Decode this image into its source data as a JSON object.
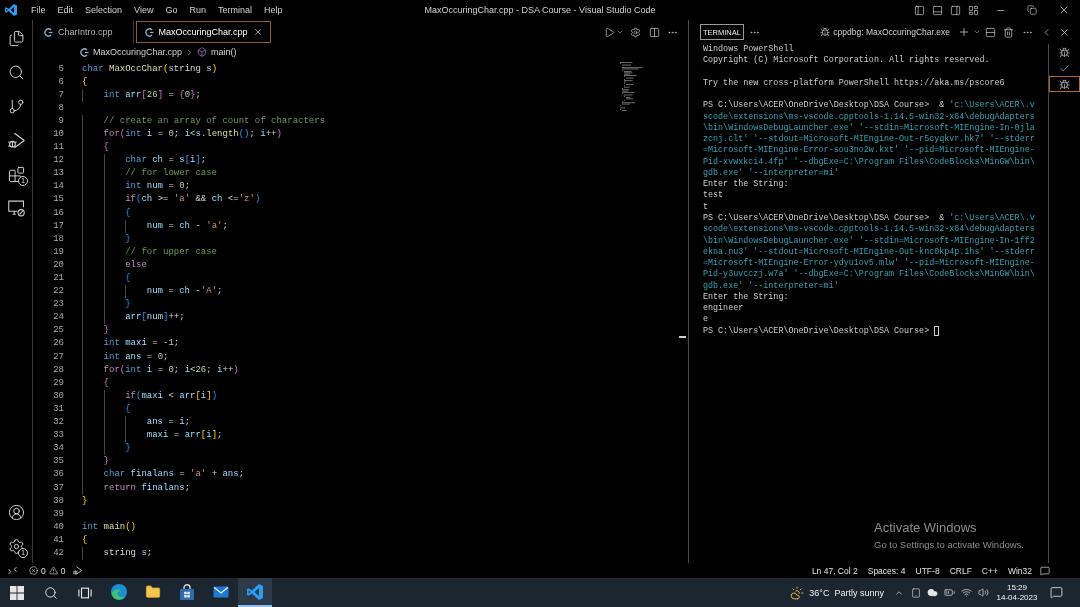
{
  "title_bar": {
    "menu": [
      "File",
      "Edit",
      "Selection",
      "View",
      "Go",
      "Run",
      "Terminal",
      "Help"
    ],
    "title": "MaxOccuringChar.cpp - DSA Course - Visual Studio Code"
  },
  "activity_bar": {
    "top": [
      {
        "kind": "explorer"
      },
      {
        "kind": "search"
      },
      {
        "kind": "source_control"
      },
      {
        "kind": "run_debug"
      },
      {
        "kind": "extensions",
        "badge": "1"
      },
      {
        "kind": "remote_explorer"
      }
    ],
    "bottom": [
      {
        "kind": "account"
      },
      {
        "kind": "manage",
        "badge": "1"
      }
    ]
  },
  "editor": {
    "tabs": [
      {
        "label": "CharIntro.cpp",
        "selected": false
      },
      {
        "label": "MaxOccuringChar.cpp",
        "selected": true
      }
    ],
    "breadcrumb": {
      "file": "MaxOccuringChar.cpp",
      "symbol": "main()"
    },
    "lines": [
      {
        "number": "5",
        "tokens": [
          {
            "text": "char",
            "kind": "type"
          },
          {
            "text": " MaxOccChar",
            "kind": "function"
          },
          {
            "text": "(",
            "kind": "bracket1"
          },
          {
            "text": "string s",
            "kind": "plain"
          },
          {
            "text": ")",
            "kind": "bracket1"
          }
        ]
      },
      {
        "number": "6",
        "tokens": [
          {
            "text": "{",
            "kind": "bracket1"
          }
        ]
      },
      {
        "number": "7",
        "tokens": [
          {
            "text": "    int",
            "kind": "type"
          },
          {
            "text": " arr",
            "kind": "variable"
          },
          {
            "text": "[",
            "kind": "bracket2"
          },
          {
            "text": "26",
            "kind": "number"
          },
          {
            "text": "]",
            "kind": "bracket2"
          },
          {
            "text": " = ",
            "kind": "plain"
          },
          {
            "text": "{",
            "kind": "bracket2"
          },
          {
            "text": "0",
            "kind": "number"
          },
          {
            "text": "}",
            "kind": "bracket2"
          },
          {
            "text": ";",
            "kind": "plain"
          }
        ]
      },
      {
        "number": "8"
      },
      {
        "number": "9",
        "tokens": [
          {
            "text": "    // create an array of count of characters",
            "kind": "comment"
          }
        ]
      },
      {
        "number": "10",
        "tokens": [
          {
            "text": "    for",
            "kind": "control"
          },
          {
            "text": "(",
            "kind": "bracket2"
          },
          {
            "text": "int",
            "kind": "type"
          },
          {
            "text": " i",
            "kind": "variable"
          },
          {
            "text": " = ",
            "kind": "plain"
          },
          {
            "text": "0",
            "kind": "number"
          },
          {
            "text": "; ",
            "kind": "plain"
          },
          {
            "text": "i",
            "kind": "variable"
          },
          {
            "text": "<",
            "kind": "plain"
          },
          {
            "text": "s",
            "kind": "variable"
          },
          {
            "text": ".",
            "kind": "plain"
          },
          {
            "text": "length",
            "kind": "function"
          },
          {
            "text": "()",
            "kind": "bracket3"
          },
          {
            "text": "; ",
            "kind": "plain"
          },
          {
            "text": "i",
            "kind": "variable"
          },
          {
            "text": "++",
            "kind": "plain"
          },
          {
            "text": ")",
            "kind": "bracket2"
          }
        ]
      },
      {
        "number": "11",
        "tokens": [
          {
            "text": "    {",
            "kind": "bracket2"
          }
        ]
      },
      {
        "number": "12",
        "tokens": [
          {
            "text": "        char",
            "kind": "type"
          },
          {
            "text": " ch",
            "kind": "variable"
          },
          {
            "text": " = ",
            "kind": "plain"
          },
          {
            "text": "s",
            "kind": "variable"
          },
          {
            "text": "[",
            "kind": "bracket3"
          },
          {
            "text": "i",
            "kind": "variable"
          },
          {
            "text": "]",
            "kind": "bracket3"
          },
          {
            "text": ";",
            "kind": "plain"
          }
        ]
      },
      {
        "number": "13",
        "tokens": [
          {
            "text": "        // for lower case",
            "kind": "comment"
          }
        ]
      },
      {
        "number": "14",
        "tokens": [
          {
            "text": "        int",
            "kind": "type"
          },
          {
            "text": " num",
            "kind": "variable"
          },
          {
            "text": " = ",
            "kind": "plain"
          },
          {
            "text": "0",
            "kind": "number"
          },
          {
            "text": ";",
            "kind": "plain"
          }
        ]
      },
      {
        "number": "15",
        "tokens": [
          {
            "text": "        if",
            "kind": "control"
          },
          {
            "text": "(",
            "kind": "bracket3"
          },
          {
            "text": "ch",
            "kind": "variable"
          },
          {
            "text": " >= ",
            "kind": "plain"
          },
          {
            "text": "'a'",
            "kind": "string"
          },
          {
            "text": " && ",
            "kind": "plain"
          },
          {
            "text": "ch",
            "kind": "variable"
          },
          {
            "text": " <=",
            "kind": "plain"
          },
          {
            "text": "'z'",
            "kind": "string"
          },
          {
            "text": ")",
            "kind": "bracket3"
          }
        ]
      },
      {
        "number": "16",
        "tokens": [
          {
            "text": "        {",
            "kind": "bracket3"
          }
        ]
      },
      {
        "number": "17",
        "tokens": [
          {
            "text": "            num",
            "kind": "variable"
          },
          {
            "text": " = ",
            "kind": "plain"
          },
          {
            "text": "ch",
            "kind": "variable"
          },
          {
            "text": " - ",
            "kind": "plain"
          },
          {
            "text": "'a'",
            "kind": "string"
          },
          {
            "text": ";",
            "kind": "plain"
          }
        ]
      },
      {
        "number": "18",
        "tokens": [
          {
            "text": "        }",
            "kind": "bracket3"
          }
        ]
      },
      {
        "number": "19",
        "tokens": [
          {
            "text": "        // for upper case",
            "kind": "comment"
          }
        ]
      },
      {
        "number": "20",
        "tokens": [
          {
            "text": "        else",
            "kind": "control"
          }
        ]
      },
      {
        "number": "21",
        "tokens": [
          {
            "text": "        {",
            "kind": "bracket3"
          }
        ]
      },
      {
        "number": "22",
        "tokens": [
          {
            "text": "            num",
            "kind": "variable"
          },
          {
            "text": " = ",
            "kind": "plain"
          },
          {
            "text": "ch",
            "kind": "variable"
          },
          {
            "text": " -",
            "kind": "plain"
          },
          {
            "text": "'A'",
            "kind": "string"
          },
          {
            "text": ";",
            "kind": "plain"
          }
        ]
      },
      {
        "number": "23",
        "tokens": [
          {
            "text": "        }",
            "kind": "bracket3"
          }
        ]
      },
      {
        "number": "24",
        "tokens": [
          {
            "text": "        arr",
            "kind": "variable"
          },
          {
            "text": "[",
            "kind": "bracket3"
          },
          {
            "text": "num",
            "kind": "variable"
          },
          {
            "text": "]",
            "kind": "bracket3"
          },
          {
            "text": "++;",
            "kind": "plain"
          }
        ]
      },
      {
        "number": "25",
        "tokens": [
          {
            "text": "    }",
            "kind": "bracket2"
          }
        ]
      },
      {
        "number": "26",
        "tokens": [
          {
            "text": "    int",
            "kind": "type"
          },
          {
            "text": " maxi",
            "kind": "variable"
          },
          {
            "text": " = ",
            "kind": "plain"
          },
          {
            "text": "-1",
            "kind": "number"
          },
          {
            "text": ";",
            "kind": "plain"
          }
        ]
      },
      {
        "number": "27",
        "tokens": [
          {
            "text": "    int",
            "kind": "type"
          },
          {
            "text": " ans",
            "kind": "variable"
          },
          {
            "text": " = ",
            "kind": "plain"
          },
          {
            "text": "0",
            "kind": "number"
          },
          {
            "text": ";",
            "kind": "plain"
          }
        ]
      },
      {
        "number": "28",
        "tokens": [
          {
            "text": "    for",
            "kind": "control"
          },
          {
            "text": "(",
            "kind": "bracket2"
          },
          {
            "text": "int",
            "kind": "type"
          },
          {
            "text": " i",
            "kind": "variable"
          },
          {
            "text": " = ",
            "kind": "plain"
          },
          {
            "text": "0",
            "kind": "number"
          },
          {
            "text": "; ",
            "kind": "plain"
          },
          {
            "text": "i",
            "kind": "variable"
          },
          {
            "text": "<",
            "kind": "plain"
          },
          {
            "text": "26",
            "kind": "number"
          },
          {
            "text": "; ",
            "kind": "plain"
          },
          {
            "text": "i",
            "kind": "variable"
          },
          {
            "text": "++",
            "kind": "plain"
          },
          {
            "text": ")",
            "kind": "bracket2"
          }
        ]
      },
      {
        "number": "29",
        "tokens": [
          {
            "text": "    {",
            "kind": "bracket2"
          }
        ]
      },
      {
        "number": "30",
        "tokens": [
          {
            "text": "        if",
            "kind": "control"
          },
          {
            "text": "(",
            "kind": "bracket3"
          },
          {
            "text": "maxi",
            "kind": "variable"
          },
          {
            "text": " < ",
            "kind": "plain"
          },
          {
            "text": "arr",
            "kind": "variable"
          },
          {
            "text": "[",
            "kind": "bracket1"
          },
          {
            "text": "i",
            "kind": "variable"
          },
          {
            "text": "]",
            "kind": "bracket1"
          },
          {
            "text": ")",
            "kind": "bracket3"
          }
        ]
      },
      {
        "number": "31",
        "tokens": [
          {
            "text": "        {",
            "kind": "bracket3"
          }
        ]
      },
      {
        "number": "32",
        "tokens": [
          {
            "text": "            ans",
            "kind": "variable"
          },
          {
            "text": " = ",
            "kind": "plain"
          },
          {
            "text": "i",
            "kind": "variable"
          },
          {
            "text": ";",
            "kind": "plain"
          }
        ]
      },
      {
        "number": "33",
        "tokens": [
          {
            "text": "            maxi",
            "kind": "variable"
          },
          {
            "text": " = ",
            "kind": "plain"
          },
          {
            "text": "arr",
            "kind": "variable"
          },
          {
            "text": "[",
            "kind": "bracket1"
          },
          {
            "text": "i",
            "kind": "variable"
          },
          {
            "text": "]",
            "kind": "bracket1"
          },
          {
            "text": ";",
            "kind": "plain"
          }
        ]
      },
      {
        "number": "34",
        "tokens": [
          {
            "text": "        }",
            "kind": "bracket3"
          }
        ]
      },
      {
        "number": "35",
        "tokens": [
          {
            "text": "    }",
            "kind": "bracket2"
          }
        ]
      },
      {
        "number": "36",
        "tokens": [
          {
            "text": "    char",
            "kind": "type"
          },
          {
            "text": " finalans",
            "kind": "variable"
          },
          {
            "text": " = ",
            "kind": "plain"
          },
          {
            "text": "'a'",
            "kind": "string"
          },
          {
            "text": " + ",
            "kind": "plain"
          },
          {
            "text": "ans",
            "kind": "variable"
          },
          {
            "text": ";",
            "kind": "plain"
          }
        ]
      },
      {
        "number": "37",
        "tokens": [
          {
            "text": "    return",
            "kind": "control"
          },
          {
            "text": " finalans",
            "kind": "variable"
          },
          {
            "text": ";",
            "kind": "plain"
          }
        ]
      },
      {
        "number": "38",
        "tokens": [
          {
            "text": "}",
            "kind": "bracket1"
          }
        ]
      },
      {
        "number": "39"
      },
      {
        "number": "40",
        "tokens": [
          {
            "text": "int",
            "kind": "type"
          },
          {
            "text": " main",
            "kind": "function"
          },
          {
            "text": "()",
            "kind": "bracket1"
          }
        ]
      },
      {
        "number": "41",
        "tokens": [
          {
            "text": "{",
            "kind": "bracket1"
          }
        ]
      },
      {
        "number": "42",
        "tokens": [
          {
            "text": "    string",
            "kind": "plain"
          },
          {
            "text": " s",
            "kind": "variable"
          },
          {
            "text": ";",
            "kind": "plain"
          }
        ]
      }
    ]
  },
  "panel": {
    "tabs": [
      {
        "label": "TERMINAL",
        "selected": true
      }
    ],
    "terminal_title": "cppdbg: MaxOccuringChar.exe",
    "terminal": {
      "blocks": [
        [
          {
            "segments": [
              {
                "text": "Windows PowerShell",
                "kind": "output"
              }
            ]
          },
          {
            "segments": [
              {
                "text": "Copyright (C) Microsoft Corporation. All rights reserved.",
                "kind": "output"
              }
            ]
          }
        ],
        [
          {
            "segments": [
              {
                "text": "Try the new cross-platform PowerShell https://aka.ms/pscore6",
                "kind": "output"
              }
            ]
          }
        ],
        [
          {
            "segments": [
              {
                "text": "PS C:\\Users\\ACER\\OneDrive\\Desktop\\DSA Course>  & ",
                "kind": "output"
              },
              {
                "text": "'c:\\Users\\ACER\\.v",
                "kind": "argument"
              }
            ]
          },
          {
            "segments": [
              {
                "text": "scode\\extensions\\ms-vscode.cpptools-1.14.5-win32-x64\\debugAdapters",
                "kind": "argument"
              }
            ]
          },
          {
            "segments": [
              {
                "text": "\\bin\\WindowsDebugLauncher.exe' '--stdin=Microsoft-MIEngine-In-0jla",
                "kind": "argument"
              }
            ]
          },
          {
            "segments": [
              {
                "text": "zcnj.clt' '--stdout=Microsoft-MIEngine-Out-r5cyqkvr.hk7' '--stderr",
                "kind": "argument"
              }
            ]
          },
          {
            "segments": [
              {
                "text": "=Microsoft-MIEngine-Error-sou3no2w.kxt' '--pid=Microsoft-MIEngine-",
                "kind": "argument"
              }
            ]
          },
          {
            "segments": [
              {
                "text": "Pid-xvwxkci4.4fp' '--dbgExe=C:\\Program Files\\CodeBlocks\\MinGW\\bin\\",
                "kind": "argument"
              }
            ]
          },
          {
            "segments": [
              {
                "text": "gdb.exe' '--interpreter=mi'",
                "kind": "argument"
              }
            ]
          },
          {
            "segments": [
              {
                "text": "Enter the String:",
                "kind": "output"
              }
            ]
          },
          {
            "segments": [
              {
                "text": "test",
                "kind": "output"
              }
            ]
          },
          {
            "segments": [
              {
                "text": "t",
                "kind": "output"
              }
            ]
          },
          {
            "segments": [
              {
                "text": "PS C:\\Users\\ACER\\OneDrive\\Desktop\\DSA Course>  & ",
                "kind": "output"
              },
              {
                "text": "'c:\\Users\\ACER\\.v",
                "kind": "argument"
              }
            ]
          },
          {
            "segments": [
              {
                "text": "scode\\extensions\\ms-vscode.cpptools-1.14.5-win32-x64\\debugAdapters",
                "kind": "argument"
              }
            ]
          },
          {
            "segments": [
              {
                "text": "\\bin\\WindowsDebugLauncher.exe' '--stdin=Microsoft-MIEngine-In-1ff2",
                "kind": "argument"
              }
            ]
          },
          {
            "segments": [
              {
                "text": "ekna.nu3' '--stdout=Microsoft-MIEngine-Out-knc0kp4p.1hs' '--stderr",
                "kind": "argument"
              }
            ]
          },
          {
            "segments": [
              {
                "text": "=Microsoft-MIEngine-Error-ydyu1ov5.mlw' '--pid=Microsoft-MIEngine-",
                "kind": "argument"
              }
            ]
          },
          {
            "segments": [
              {
                "text": "Pid-y3uvcczj.w7a' '--dbgExe=C:\\Program Files\\CodeBlocks\\MinGW\\bin\\",
                "kind": "argument"
              }
            ]
          },
          {
            "segments": [
              {
                "text": "gdb.exe' '--interpreter=mi'",
                "kind": "argument"
              }
            ]
          },
          {
            "segments": [
              {
                "text": "Enter the String:",
                "kind": "output"
              }
            ]
          },
          {
            "segments": [
              {
                "text": "engineer",
                "kind": "output"
              }
            ]
          },
          {
            "segments": [
              {
                "text": "e",
                "kind": "output"
              }
            ]
          },
          {
            "segments": [
              {
                "text": "PS C:\\Users\\ACER\\OneDrive\\Desktop\\DSA Course>",
                "kind": "output"
              }
            ],
            "cursor": true
          }
        ]
      ]
    },
    "sessions": [
      {
        "kind": "debug",
        "selected": false
      },
      {
        "kind": "task",
        "selected": false
      },
      {
        "kind": "debug",
        "selected": true
      }
    ]
  },
  "status_bar": {
    "errors": "0",
    "warnings": "0",
    "items": [
      "Ln 47, Col 2",
      "Spaces: 4",
      "UTF-8",
      "CRLF",
      "C++",
      "Win32"
    ]
  },
  "taskbar": {
    "buttons": [
      {
        "kind": "start"
      },
      {
        "kind": "search"
      },
      {
        "kind": "task_view"
      }
    ],
    "apps": [
      {
        "kind": "edge",
        "active": false
      },
      {
        "kind": "file_explorer",
        "active": false
      },
      {
        "kind": "store",
        "active": false
      },
      {
        "kind": "mail",
        "active": false
      },
      {
        "kind": "vscode",
        "active": true
      }
    ],
    "weather": {
      "temperature": "36°C",
      "condition": "Partly sunny"
    },
    "time": "15:29",
    "date": "14-04-2023"
  },
  "os_overlay": {
    "title": "Activate Windows",
    "message": "Go to Settings to activate Windows."
  }
}
